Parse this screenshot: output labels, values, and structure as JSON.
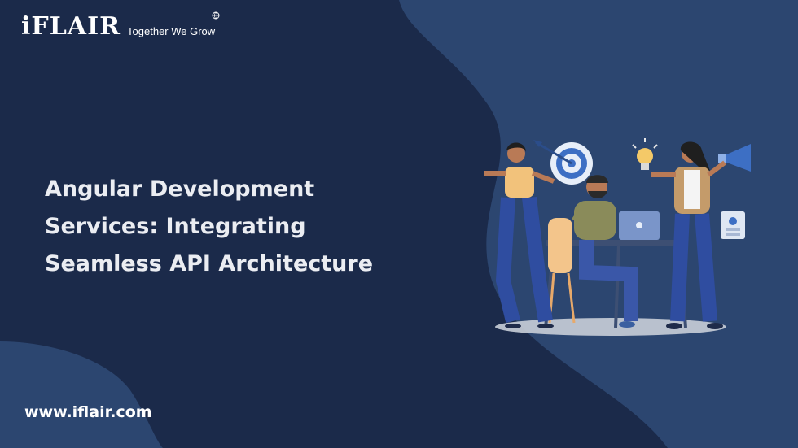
{
  "brand": {
    "logo_text": "iFLAIR",
    "tagline": "Together We Grow"
  },
  "headline": {
    "lines": [
      "Angular Development",
      "Services: Integrating",
      "Seamless API Architecture"
    ]
  },
  "footer": {
    "website": "www.iflair.com"
  },
  "colors": {
    "background": "#1b2a4a",
    "accent_shape": "#2c4670",
    "text": "#ebedf2"
  },
  "illustration": {
    "icons": [
      "target-icon",
      "lightbulb-icon",
      "megaphone-icon",
      "profile-card-icon",
      "laptop-icon"
    ]
  }
}
